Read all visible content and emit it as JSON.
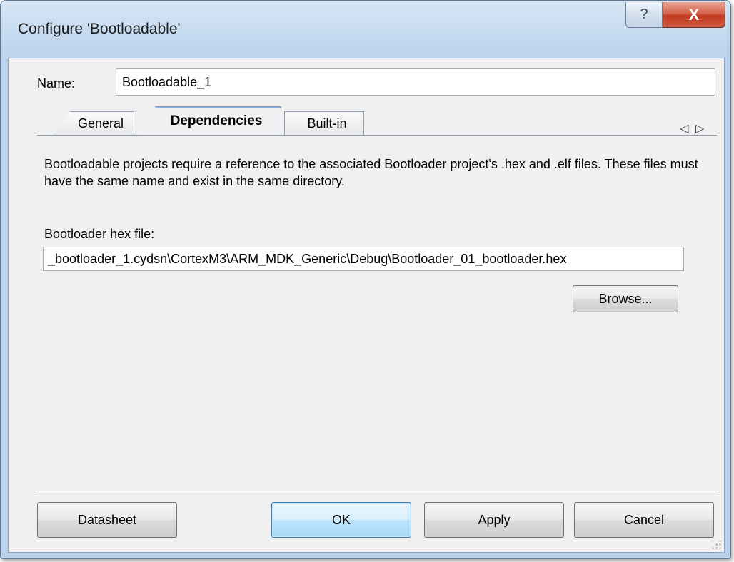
{
  "window": {
    "title": "Configure 'Bootloadable'",
    "help_glyph": "?",
    "close_glyph": "X"
  },
  "name_row": {
    "label": "Name:",
    "value": "Bootloadable_1"
  },
  "tabs": [
    {
      "label": "General",
      "active": false
    },
    {
      "label": "Dependencies",
      "active": true
    },
    {
      "label": "Built-in",
      "active": false
    }
  ],
  "tab_scroll": {
    "left_glyph": "◁",
    "right_glyph": "▷"
  },
  "dependencies": {
    "description": "Bootloadable projects require a reference to the associated Bootloader project's .hex and .elf files. These files must have the same name and exist in the same directory.",
    "hex_label": "Bootloader hex file:",
    "hex_value": "_bootloader_1.cydsn\\CortexM3\\ARM_MDK_Generic\\Debug\\Bootloader_01_bootloader.hex",
    "browse_label": "Browse..."
  },
  "buttons": {
    "datasheet": "Datasheet",
    "ok": "OK",
    "apply": "Apply",
    "cancel": "Cancel"
  }
}
